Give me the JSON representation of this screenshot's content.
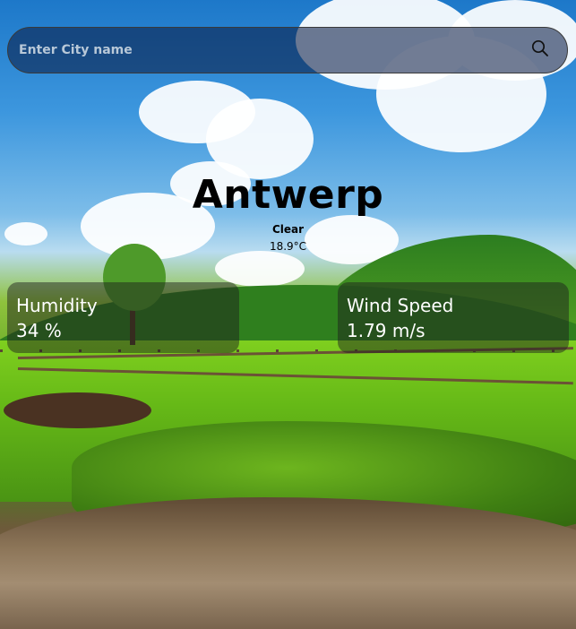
{
  "search": {
    "placeholder": "Enter City name",
    "value": "",
    "icon": "search-icon"
  },
  "weather": {
    "city": "Antwerp",
    "condition": "Clear",
    "temperature": "18.9°C"
  },
  "cards": {
    "humidity": {
      "label": "Humidity",
      "value": "34 %"
    },
    "wind": {
      "label": "Wind Speed",
      "value": "1.79 m/s"
    }
  },
  "colors": {
    "text_primary": "#000000",
    "card_text": "#ffffff"
  }
}
